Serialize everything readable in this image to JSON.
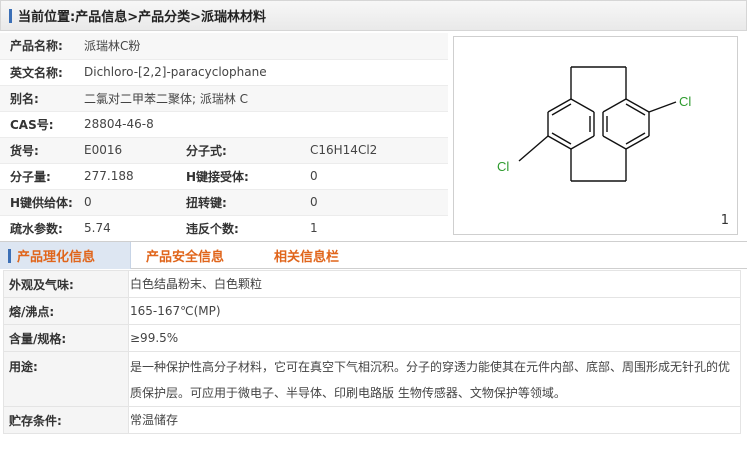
{
  "breadcrumb": "当前位置:产品信息>产品分类>派瑞林材料",
  "info_rows": [
    {
      "label": "产品名称:",
      "value": "派瑞林C粉"
    },
    {
      "label": "英文名称:",
      "value": "Dichloro-[2,2]-paracyclophane"
    },
    {
      "label": "别名:",
      "value": "二氯对二甲苯二聚体; 派瑞林 C"
    },
    {
      "label": "CAS号:",
      "value": "28804-46-8"
    },
    {
      "label": "货号:",
      "value": "E0016",
      "label2": "分子式:",
      "value2": "C16H14Cl2"
    },
    {
      "label": "分子量:",
      "value": "277.188",
      "label2": "H键接受体:",
      "value2": "0"
    },
    {
      "label": "H键供给体:",
      "value": "0",
      "label2": "扭转键:",
      "value2": "0"
    },
    {
      "label": "疏水参数:",
      "value": "5.74",
      "label2": "违反个数:",
      "value2": "1"
    }
  ],
  "structure": {
    "atom_cl_1": "Cl",
    "atom_cl_2": "Cl",
    "page_number": "1"
  },
  "tabs": [
    {
      "label": "产品理化信息",
      "active": true
    },
    {
      "label": "产品安全信息",
      "active": false
    },
    {
      "label": "相关信息栏",
      "active": false
    }
  ],
  "props": [
    {
      "label": "外观及气味:",
      "value": "白色结晶粉末、白色颗粒"
    },
    {
      "label": "熔/沸点:",
      "value": "165-167℃(MP)"
    },
    {
      "label": "含量/规格:",
      "value": "≥99.5%"
    },
    {
      "label": "用途:",
      "value": "是一种保护性高分子材料，它可在真空下气相沉积。分子的穿透力能使其在元件内部、底部、周围形成无针孔的优质保护层。可应用于微电子、半导体、印刷电路版 生物传感器、文物保护等领域。"
    },
    {
      "label": "贮存条件:",
      "value": "常温储存"
    }
  ],
  "colors": {
    "accent_blue": "#3b6fb6",
    "tab_orange": "#e0651b",
    "chlorine_green": "#2e9b2e"
  }
}
